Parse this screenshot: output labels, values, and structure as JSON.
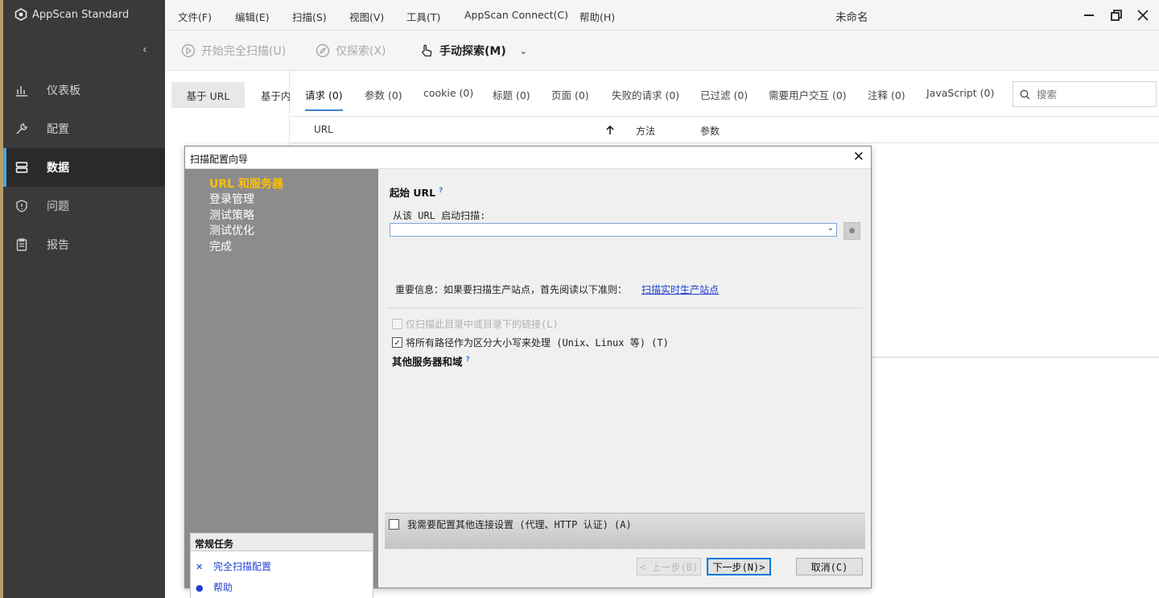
{
  "app": {
    "brand": "AppScan Standard",
    "doc_title": "未命名",
    "accent": "#4aa3df"
  },
  "menu": [
    "文件(F)",
    "编辑(E)",
    "扫描(S)",
    "视图(V)",
    "工具(T)",
    "AppScan Connect(C)",
    "帮助(H)"
  ],
  "toolbar": {
    "full_scan": "开始完全扫描(U)",
    "explore_only": "仅探索(X)",
    "manual_explore": "手动探索(M)"
  },
  "sidebar": {
    "items": [
      {
        "label": "仪表板",
        "icon": "bar-chart-icon"
      },
      {
        "label": "配置",
        "icon": "wrench-icon"
      },
      {
        "label": "数据",
        "icon": "database-icon",
        "active": true
      },
      {
        "label": "问题",
        "icon": "shield-icon"
      },
      {
        "label": "报告",
        "icon": "clipboard-icon"
      }
    ]
  },
  "view_tabs": [
    "基于 URL",
    "基于内"
  ],
  "content_tabs": [
    "请求 (0)",
    "参数 (0)",
    "cookie (0)",
    "标题 (0)",
    "页面 (0)",
    "失败的请求 (0)",
    "已过滤 (0)",
    "需要用户交互 (0)",
    "注释 (0)",
    "JavaScript (0)"
  ],
  "search": {
    "placeholder": "搜索"
  },
  "table": {
    "columns": [
      "URL",
      "方法",
      "参数"
    ]
  },
  "dialog": {
    "title": "扫描配置向导",
    "steps": [
      "URL 和服务器",
      "登录管理",
      "测试策略",
      "测试优化",
      "完成"
    ],
    "tasks_header": "常规任务",
    "tasks": [
      "完全扫描配置",
      "帮助"
    ],
    "start_url_title": "起始 URL",
    "start_url_label": "从该 URL 启动扫描:",
    "start_url_value": "",
    "info_text": "重要信息：如果要扫描生产站点，首先阅读以下准则：",
    "info_link": "扫描实时生产站点",
    "chk_dir_only": "仅扫描此目录中或目录下的链接(L)",
    "chk_case_sensitive": "将所有路径作为区分大小写来处理 (Unix、Linux 等) (T)",
    "other_servers_title": "其他服务器和域",
    "chk_conn_settings": "我需要配置其他连接设置 (代理、HTTP 认证) (A)",
    "btn_prev": "< 上一步(B)",
    "btn_next": "下一步(N)>",
    "btn_cancel": "取消(C)"
  }
}
